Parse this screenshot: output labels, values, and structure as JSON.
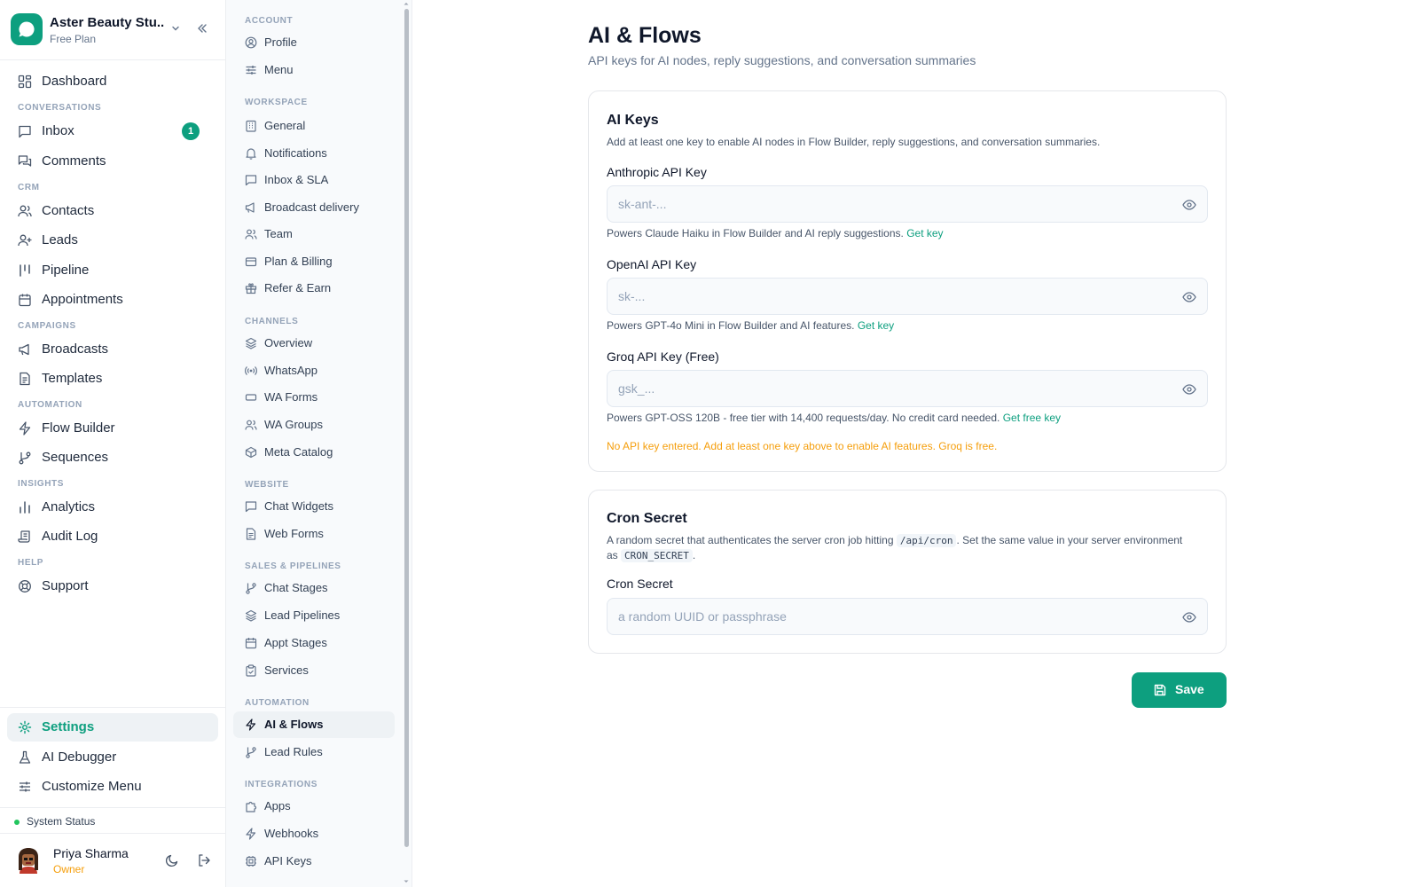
{
  "workspace": {
    "name": "Aster Beauty Stu...",
    "plan": "Free Plan"
  },
  "sidebar": {
    "sections": {
      "conversations": "CONVERSATIONS",
      "crm": "CRM",
      "campaigns": "CAMPAIGNS",
      "automation": "AUTOMATION",
      "insights": "INSIGHTS",
      "help": "HELP"
    },
    "items": {
      "dashboard": "Dashboard",
      "inbox": "Inbox",
      "inbox_badge": "1",
      "comments": "Comments",
      "contacts": "Contacts",
      "leads": "Leads",
      "pipeline": "Pipeline",
      "appointments": "Appointments",
      "broadcasts": "Broadcasts",
      "templates": "Templates",
      "flow_builder": "Flow Builder",
      "sequences": "Sequences",
      "analytics": "Analytics",
      "audit_log": "Audit Log",
      "support": "Support",
      "settings": "Settings",
      "ai_debugger": "AI Debugger",
      "customize_menu": "Customize Menu"
    },
    "system_status": "System Status",
    "user": {
      "name": "Priya Sharma",
      "role": "Owner"
    }
  },
  "subnav": {
    "sections": {
      "account": "ACCOUNT",
      "workspace": "WORKSPACE",
      "channels": "CHANNELS",
      "website": "WEBSITE",
      "sales": "SALES & PIPELINES",
      "automation": "AUTOMATION",
      "integrations": "INTEGRATIONS"
    },
    "items": {
      "profile": "Profile",
      "menu": "Menu",
      "general": "General",
      "notifications": "Notifications",
      "inbox_sla": "Inbox & SLA",
      "broadcast_delivery": "Broadcast delivery",
      "team": "Team",
      "plan_billing": "Plan & Billing",
      "refer_earn": "Refer & Earn",
      "overview": "Overview",
      "whatsapp": "WhatsApp",
      "wa_forms": "WA Forms",
      "wa_groups": "WA Groups",
      "meta_catalog": "Meta Catalog",
      "chat_widgets": "Chat Widgets",
      "web_forms": "Web Forms",
      "chat_stages": "Chat Stages",
      "lead_pipelines": "Lead Pipelines",
      "appt_stages": "Appt Stages",
      "services": "Services",
      "ai_flows": "AI & Flows",
      "lead_rules": "Lead Rules",
      "apps": "Apps",
      "webhooks": "Webhooks",
      "api_keys": "API Keys"
    }
  },
  "main": {
    "title": "AI & Flows",
    "subtitle": "API keys for AI nodes, reply suggestions, and conversation summaries",
    "ai_keys": {
      "title": "AI Keys",
      "desc": "Add at least one key to enable AI nodes in Flow Builder, reply suggestions, and conversation summaries.",
      "anthropic": {
        "label": "Anthropic API Key",
        "placeholder": "sk-ant-...",
        "value": "",
        "help": "Powers Claude Haiku in Flow Builder and AI reply suggestions.",
        "link": "Get key"
      },
      "openai": {
        "label": "OpenAI API Key",
        "placeholder": "sk-...",
        "value": "",
        "help": "Powers GPT-4o Mini in Flow Builder and AI features.",
        "link": "Get key"
      },
      "groq": {
        "label": "Groq API Key (Free)",
        "placeholder": "gsk_...",
        "value": "",
        "help": "Powers GPT-OSS 120B - free tier with 14,400 requests/day. No credit card needed.",
        "link": "Get free key"
      },
      "warning": "No API key entered. Add at least one key above to enable AI features. Groq is free."
    },
    "cron": {
      "title": "Cron Secret",
      "desc_1": "A random secret that authenticates the server cron job hitting",
      "code_1": "/api/cron",
      "desc_2": ". Set the same value in your server environment as",
      "code_2": "CRON_SECRET",
      "desc_3": ".",
      "label": "Cron Secret",
      "placeholder": "a random UUID or passphrase",
      "value": ""
    },
    "save_label": "Save"
  },
  "colors": {
    "accent": "#0d9f7f",
    "warning": "#f59e0b",
    "status_ok": "#22c55e"
  }
}
